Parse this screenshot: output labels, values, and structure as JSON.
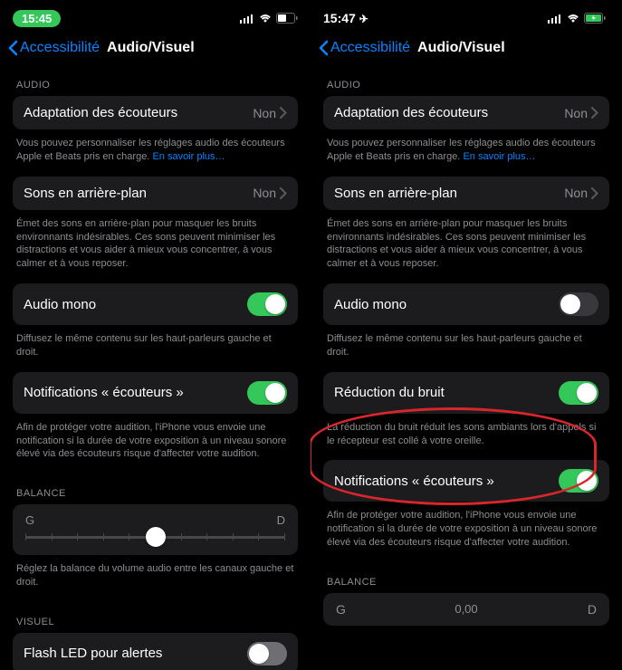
{
  "left": {
    "status": {
      "time": "15:45"
    },
    "nav": {
      "back": "Accessibilité",
      "title": "Audio/Visuel"
    },
    "section_audio": "AUDIO",
    "headphone": {
      "label": "Adaptation des écouteurs",
      "value": "Non"
    },
    "headphone_footer_a": "Vous pouvez personnaliser les réglages audio des écouteurs Apple et Beats pris en charge. ",
    "headphone_footer_link": "En savoir plus…",
    "bg_sounds": {
      "label": "Sons en arrière-plan",
      "value": "Non"
    },
    "bg_sounds_footer": "Émet des sons en arrière-plan pour masquer les bruits environnants indésirables. Ces sons peuvent minimiser les distractions et vous aider à mieux vous concentrer, à vous calmer et à vous reposer.",
    "mono": {
      "label": "Audio mono"
    },
    "mono_footer": "Diffusez le même contenu sur les haut-parleurs gauche et droit.",
    "notif": {
      "label": "Notifications « écouteurs »"
    },
    "notif_footer": "Afin de protéger votre audition, l'iPhone vous envoie une notification si la durée de votre exposition à un niveau sonore élevé via des écouteurs risque d'affecter votre audition.",
    "balance_header": "BALANCE",
    "balance_left": "G",
    "balance_right": "D",
    "balance_footer": "Réglez la balance du volume audio entre les canaux gauche et droit.",
    "section_visual": "VISUEL",
    "led": {
      "label": "Flash LED pour alertes"
    }
  },
  "right": {
    "status": {
      "time": "15:47"
    },
    "nav": {
      "back": "Accessibilité",
      "title": "Audio/Visuel"
    },
    "section_audio": "AUDIO",
    "headphone": {
      "label": "Adaptation des écouteurs",
      "value": "Non"
    },
    "headphone_footer_a": "Vous pouvez personnaliser les réglages audio des écouteurs Apple et Beats pris en charge. ",
    "headphone_footer_link": "En savoir plus…",
    "bg_sounds": {
      "label": "Sons en arrière-plan",
      "value": "Non"
    },
    "bg_sounds_footer": "Émet des sons en arrière-plan pour masquer les bruits environnants indésirables. Ces sons peuvent minimiser les distractions et vous aider à mieux vous concentrer, à vous calmer et à vous reposer.",
    "mono": {
      "label": "Audio mono"
    },
    "mono_footer": "Diffusez le même contenu sur les haut-parleurs gauche et droit.",
    "noise": {
      "label": "Réduction du bruit"
    },
    "noise_footer": "La réduction du bruit réduit les sons ambiants lors d'appels si le récepteur est collé à votre oreille.",
    "notif": {
      "label": "Notifications « écouteurs »"
    },
    "notif_footer": "Afin de protéger votre audition, l'iPhone vous envoie une notification si la durée de votre exposition à un niveau sonore élevé via des écouteurs risque d'affecter votre audition.",
    "balance_header": "BALANCE",
    "balance_left": "G",
    "balance_center": "0,00",
    "balance_right": "D"
  }
}
